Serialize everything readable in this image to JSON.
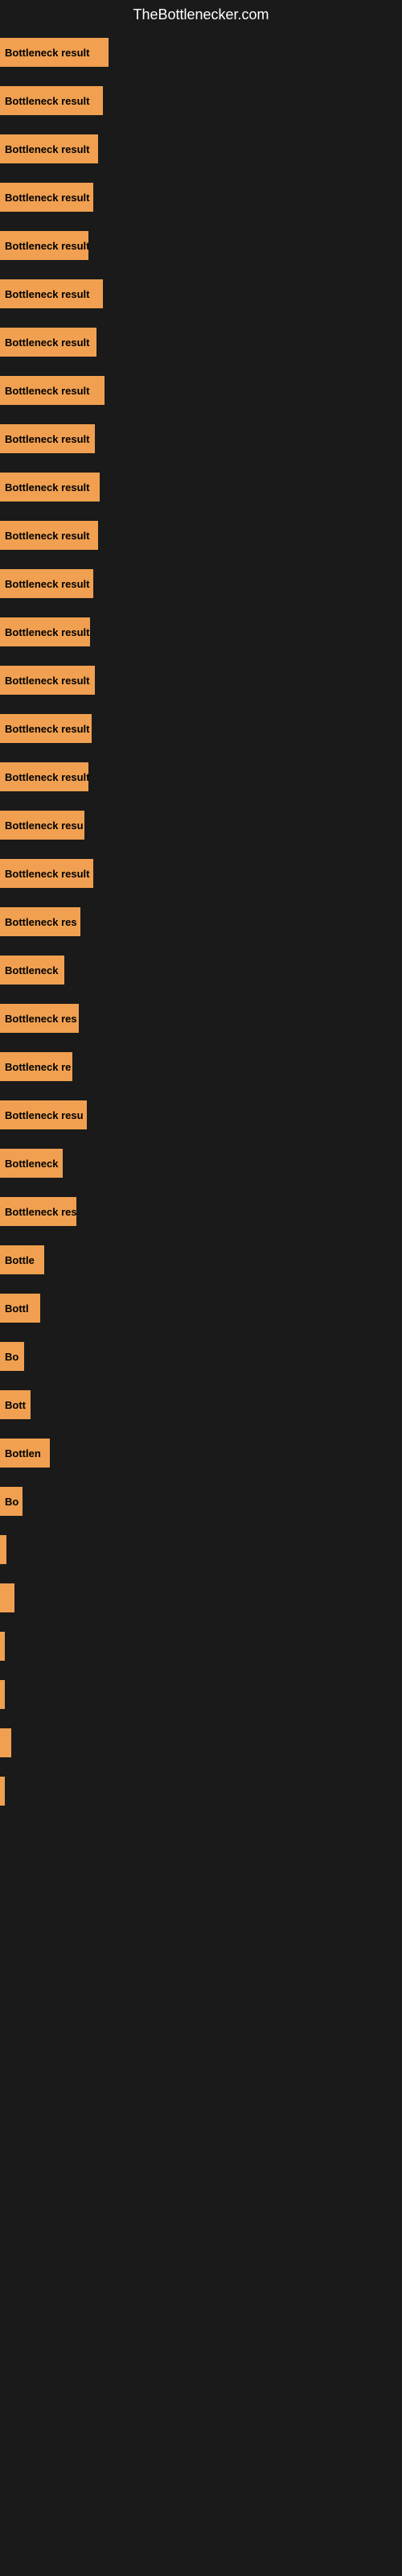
{
  "site_title": "TheBottlenecker.com",
  "bars": [
    {
      "label": "Bottleneck result",
      "width": 135
    },
    {
      "label": "Bottleneck result",
      "width": 128
    },
    {
      "label": "Bottleneck result",
      "width": 122
    },
    {
      "label": "Bottleneck result",
      "width": 116
    },
    {
      "label": "Bottleneck result",
      "width": 110
    },
    {
      "label": "Bottleneck result",
      "width": 128
    },
    {
      "label": "Bottleneck result",
      "width": 120
    },
    {
      "label": "Bottleneck result",
      "width": 130
    },
    {
      "label": "Bottleneck result",
      "width": 118
    },
    {
      "label": "Bottleneck result",
      "width": 124
    },
    {
      "label": "Bottleneck result",
      "width": 122
    },
    {
      "label": "Bottleneck result",
      "width": 116
    },
    {
      "label": "Bottleneck result",
      "width": 112
    },
    {
      "label": "Bottleneck result",
      "width": 118
    },
    {
      "label": "Bottleneck result",
      "width": 114
    },
    {
      "label": "Bottleneck result",
      "width": 110
    },
    {
      "label": "Bottleneck resu",
      "width": 105
    },
    {
      "label": "Bottleneck result",
      "width": 116
    },
    {
      "label": "Bottleneck res",
      "width": 100
    },
    {
      "label": "Bottleneck",
      "width": 80
    },
    {
      "label": "Bottleneck res",
      "width": 98
    },
    {
      "label": "Bottleneck re",
      "width": 90
    },
    {
      "label": "Bottleneck resu",
      "width": 108
    },
    {
      "label": "Bottleneck",
      "width": 78
    },
    {
      "label": "Bottleneck res",
      "width": 95
    },
    {
      "label": "Bottle",
      "width": 55
    },
    {
      "label": "Bottl",
      "width": 50
    },
    {
      "label": "Bo",
      "width": 30
    },
    {
      "label": "Bott",
      "width": 38
    },
    {
      "label": "Bottlen",
      "width": 62
    },
    {
      "label": "Bo",
      "width": 28
    },
    {
      "label": "",
      "width": 8
    },
    {
      "label": "",
      "width": 18
    },
    {
      "label": "",
      "width": 6
    },
    {
      "label": "",
      "width": 2
    },
    {
      "label": "",
      "width": 14
    },
    {
      "label": "",
      "width": 4
    }
  ]
}
